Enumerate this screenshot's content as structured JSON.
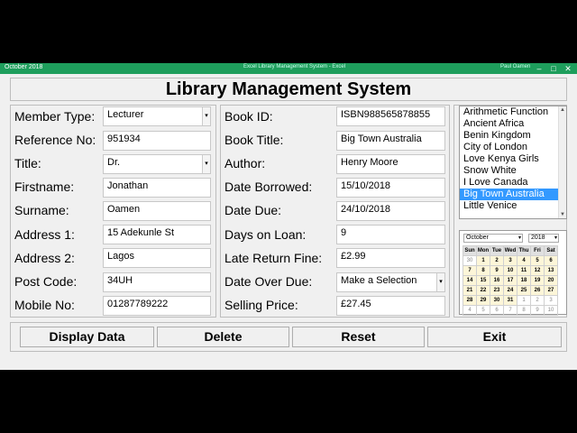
{
  "titlebar": {
    "left_text": "October 2018",
    "center_text": "Excel Library Management System - Excel",
    "right_text": "Paul Oamen",
    "accent": "#1e9e5c"
  },
  "title": "Library Management System",
  "member": {
    "member_type": {
      "label": "Member Type:",
      "value": "Lecturer"
    },
    "reference_no": {
      "label": "Reference No:",
      "value": "951934"
    },
    "title": {
      "label": "Title:",
      "value": "Dr."
    },
    "firstname": {
      "label": "Firstname:",
      "value": "Jonathan"
    },
    "surname": {
      "label": "Surname:",
      "value": "Oamen"
    },
    "address1": {
      "label": "Address 1:",
      "value": "15 Adekunle St"
    },
    "address2": {
      "label": "Address 2:",
      "value": "Lagos"
    },
    "post_code": {
      "label": "Post Code:",
      "value": "34UH"
    },
    "mobile_no": {
      "label": "Mobile No:",
      "value": "01287789222"
    }
  },
  "book": {
    "book_id": {
      "label": "Book ID:",
      "value": "ISBN988565878855"
    },
    "book_title": {
      "label": "Book Title:",
      "value": "Big Town Australia"
    },
    "author": {
      "label": "Author:",
      "value": "Henry Moore"
    },
    "date_borrowed": {
      "label": "Date Borrowed:",
      "value": "15/10/2018"
    },
    "date_due": {
      "label": "Date Due:",
      "value": "24/10/2018"
    },
    "days_on_loan": {
      "label": "Days on Loan:",
      "value": "9"
    },
    "late_return_fine": {
      "label": "Late Return Fine:",
      "value": "£2.99"
    },
    "date_over_due": {
      "label": "Date Over Due:",
      "value": "Make a Selection"
    },
    "selling_price": {
      "label": "Selling Price:",
      "value": "£27.45"
    }
  },
  "book_list": {
    "items": [
      "Arithmetic Function",
      "Ancient Africa",
      "Benin Kingdom",
      "City of London",
      "Love Kenya Girls",
      "Snow White",
      "I Love Canada",
      "Big Town Australia",
      "Little Venice"
    ],
    "selected_index": 7,
    "selection_color": "#3399ff"
  },
  "calendar": {
    "month": "October",
    "year": "2018",
    "days": [
      "Sun",
      "Mon",
      "Tue",
      "Wed",
      "Thu",
      "Fri",
      "Sat"
    ],
    "weeks": [
      [
        "30",
        "1",
        "2",
        "3",
        "4",
        "5",
        "6"
      ],
      [
        "7",
        "8",
        "9",
        "10",
        "11",
        "12",
        "13"
      ],
      [
        "14",
        "15",
        "16",
        "17",
        "18",
        "19",
        "20"
      ],
      [
        "21",
        "22",
        "23",
        "24",
        "25",
        "26",
        "27"
      ],
      [
        "28",
        "29",
        "30",
        "31",
        "1",
        "2",
        "3"
      ],
      [
        "4",
        "5",
        "6",
        "7",
        "8",
        "9",
        "10"
      ]
    ]
  },
  "buttons": {
    "display": "Display Data",
    "delete": "Delete",
    "reset": "Reset",
    "exit": "Exit"
  }
}
